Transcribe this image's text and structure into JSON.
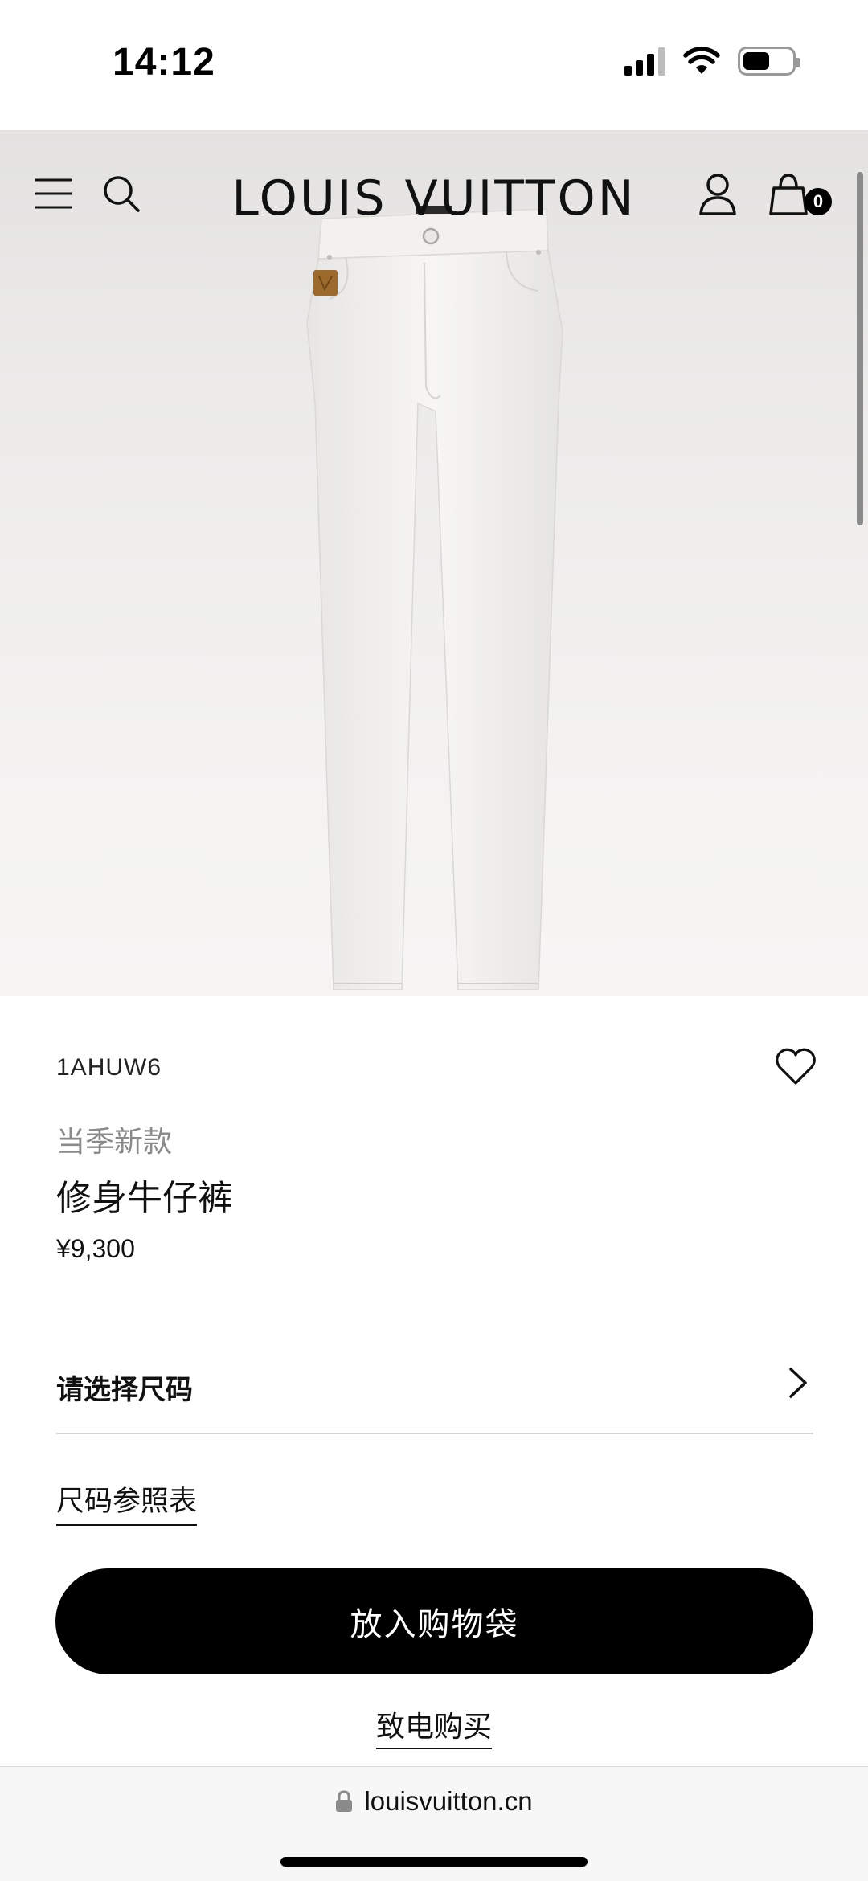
{
  "status_bar": {
    "time": "14:12",
    "battery_level": 0.55
  },
  "header": {
    "brand": "LOUIS VUITTON",
    "cart_count": "0",
    "icons": [
      "menu-icon",
      "search-icon",
      "user-icon",
      "shopping-bag-icon"
    ]
  },
  "product": {
    "sku": "1AHUW6",
    "season_tag": "当季新款",
    "name": "修身牛仔裤",
    "price": "¥9,300",
    "image_colors": {
      "denim": "#f4f3f1",
      "patch": "#9b6a2c"
    }
  },
  "actions": {
    "size_select_label": "请选择尺码",
    "size_guide_label": "尺码参照表",
    "add_to_bag_label": "放入购物袋",
    "phone_order_label": "致电购买"
  },
  "browser": {
    "url": "louisvuitton.cn"
  },
  "colors": {
    "accent": "#000000",
    "muted_text": "#8a8a8a",
    "divider": "#d4d4d4"
  }
}
